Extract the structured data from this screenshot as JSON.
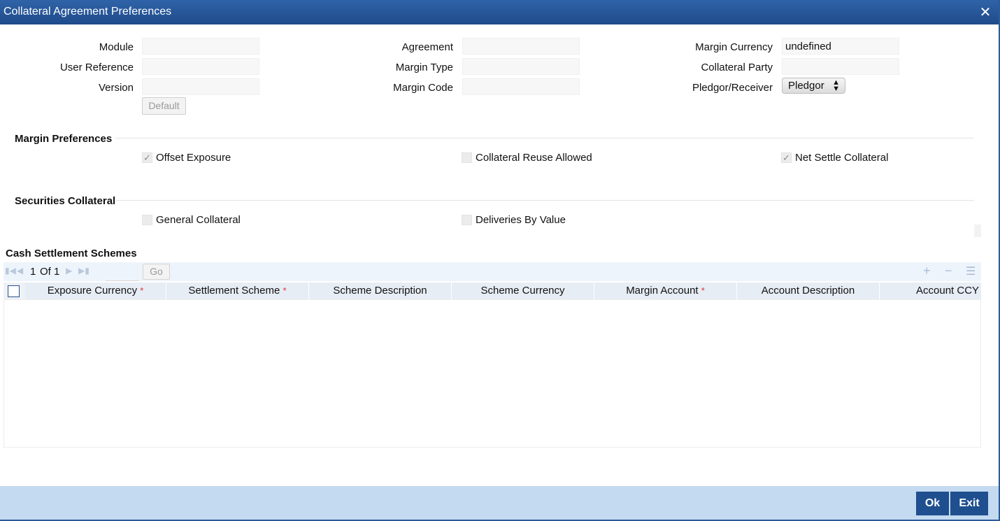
{
  "window": {
    "title": "Collateral Agreement Preferences",
    "close_glyph": "✕"
  },
  "header": {
    "module_label": "Module",
    "user_reference_label": "User Reference",
    "version_label": "Version",
    "default_button": "Default",
    "agreement_label": "Agreement",
    "margin_type_label": "Margin Type",
    "margin_code_label": "Margin Code",
    "margin_currency_label": "Margin Currency",
    "margin_currency_value": "undefined",
    "collateral_party_label": "Collateral Party",
    "pledgor_receiver_label": "Pledgor/Receiver",
    "pledgor_receiver_value": "Pledgor"
  },
  "margin_preferences": {
    "title": "Margin Preferences",
    "offset_exposure": {
      "label": "Offset Exposure",
      "checked": true
    },
    "collateral_reuse_allowed": {
      "label": "Collateral Reuse Allowed",
      "checked": false
    },
    "net_settle_collateral": {
      "label": "Net Settle Collateral",
      "checked": true
    }
  },
  "securities_collateral": {
    "title": "Securities Collateral",
    "general_collateral": {
      "label": "General Collateral",
      "checked": false
    },
    "deliveries_by_value": {
      "label": "Deliveries By Value",
      "checked": false
    }
  },
  "cash_settlement": {
    "title": "Cash Settlement Schemes",
    "pager": {
      "current": "1",
      "of_label": "Of",
      "total": "1",
      "go_label": "Go"
    },
    "columns": [
      {
        "label": "Exposure Currency",
        "required": true
      },
      {
        "label": "Settlement Scheme",
        "required": true
      },
      {
        "label": "Scheme Description",
        "required": false
      },
      {
        "label": "Scheme Currency",
        "required": false
      },
      {
        "label": "Margin Account",
        "required": true
      },
      {
        "label": "Account Description",
        "required": false
      },
      {
        "label": "Account CCY",
        "required": false
      }
    ],
    "required_marker": "*"
  },
  "footer": {
    "ok_label": "Ok",
    "exit_label": "Exit"
  },
  "colors": {
    "title_bar": "#2558a0",
    "footer": "#c4daf0",
    "button": "#1f4f8f",
    "required": "#dd3333"
  }
}
